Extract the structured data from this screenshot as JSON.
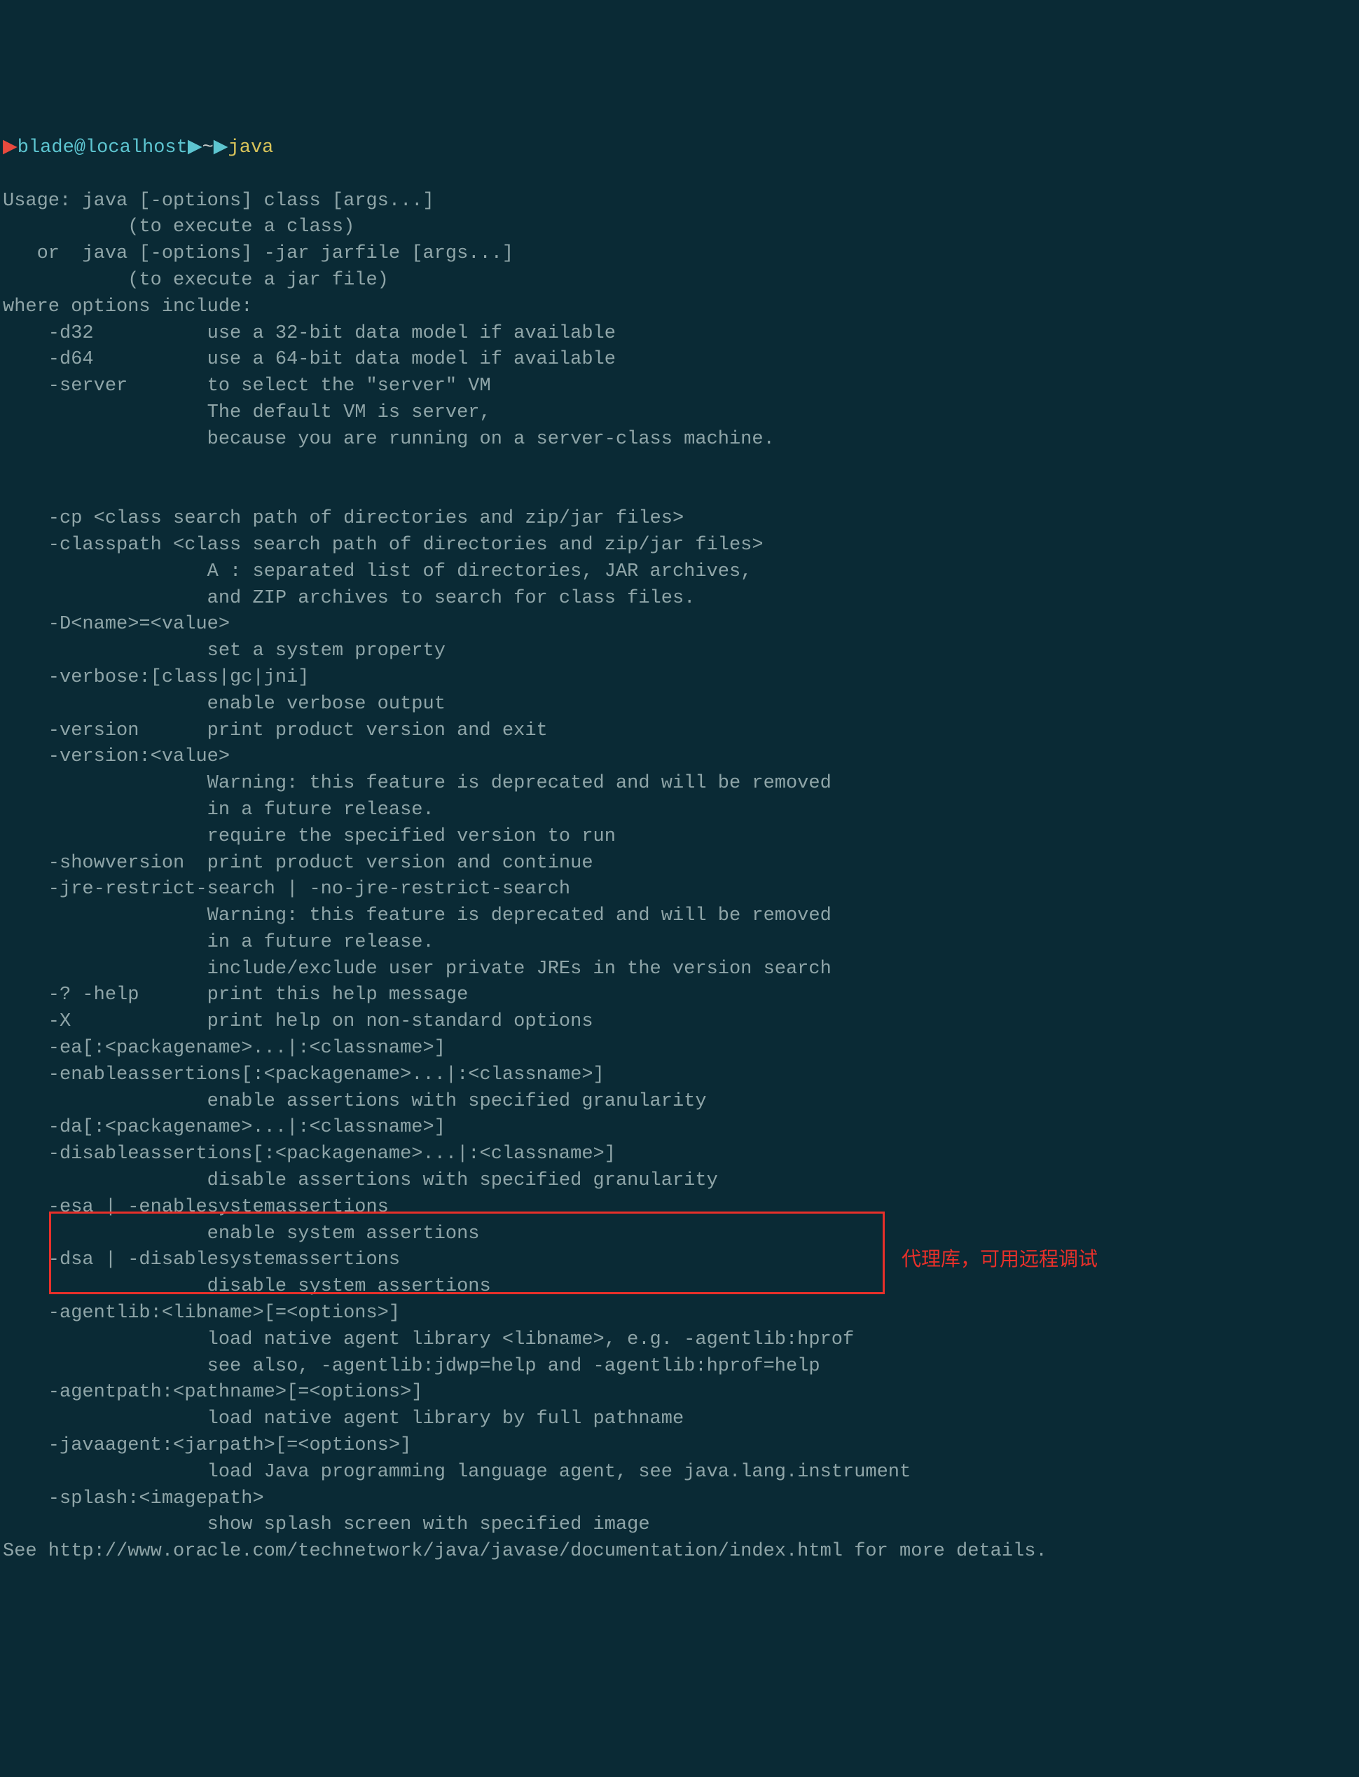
{
  "prompt": {
    "arrow": "▶",
    "user_host": "blade@localhost",
    "separator1": "▶",
    "path": "~",
    "separator2": "▶",
    "command": "java"
  },
  "output": {
    "line1": "Usage: java [-options] class [args...]",
    "line2": "           (to execute a class)",
    "line3": "   or  java [-options] -jar jarfile [args...]",
    "line4": "           (to execute a jar file)",
    "line5": "where options include:",
    "line6": "    -d32          use a 32-bit data model if available",
    "line7": "    -d64          use a 64-bit data model if available",
    "line8": "    -server       to select the \"server\" VM",
    "line9": "                  The default VM is server,",
    "line10": "                  because you are running on a server-class machine.",
    "line11": "",
    "line12": "",
    "line13": "    -cp <class search path of directories and zip/jar files>",
    "line14": "    -classpath <class search path of directories and zip/jar files>",
    "line15": "                  A : separated list of directories, JAR archives,",
    "line16": "                  and ZIP archives to search for class files.",
    "line17": "    -D<name>=<value>",
    "line18": "                  set a system property",
    "line19": "    -verbose:[class|gc|jni]",
    "line20": "                  enable verbose output",
    "line21": "    -version      print product version and exit",
    "line22": "    -version:<value>",
    "line23": "                  Warning: this feature is deprecated and will be removed",
    "line24": "                  in a future release.",
    "line25": "                  require the specified version to run",
    "line26": "    -showversion  print product version and continue",
    "line27": "    -jre-restrict-search | -no-jre-restrict-search",
    "line28": "                  Warning: this feature is deprecated and will be removed",
    "line29": "                  in a future release.",
    "line30": "                  include/exclude user private JREs in the version search",
    "line31": "    -? -help      print this help message",
    "line32": "    -X            print help on non-standard options",
    "line33": "    -ea[:<packagename>...|:<classname>]",
    "line34": "    -enableassertions[:<packagename>...|:<classname>]",
    "line35": "                  enable assertions with specified granularity",
    "line36": "    -da[:<packagename>...|:<classname>]",
    "line37": "    -disableassertions[:<packagename>...|:<classname>]",
    "line38": "                  disable assertions with specified granularity",
    "line39": "    -esa | -enablesystemassertions",
    "line40": "                  enable system assertions",
    "line41": "    -dsa | -disablesystemassertions",
    "line42": "                  disable system assertions",
    "line43": "    -agentlib:<libname>[=<options>]",
    "line44": "                  load native agent library <libname>, e.g. -agentlib:hprof",
    "line45": "                  see also, -agentlib:jdwp=help and -agentlib:hprof=help",
    "line46": "    -agentpath:<pathname>[=<options>]",
    "line47": "                  load native agent library by full pathname",
    "line48": "    -javaagent:<jarpath>[=<options>]",
    "line49": "                  load Java programming language agent, see java.lang.instrument",
    "line50": "    -splash:<imagepath>",
    "line51": "                  show splash screen with specified image",
    "line52": "See http://www.oracle.com/technetwork/java/javase/documentation/index.html for more details."
  },
  "annotation": "代理库，可用远程调试"
}
